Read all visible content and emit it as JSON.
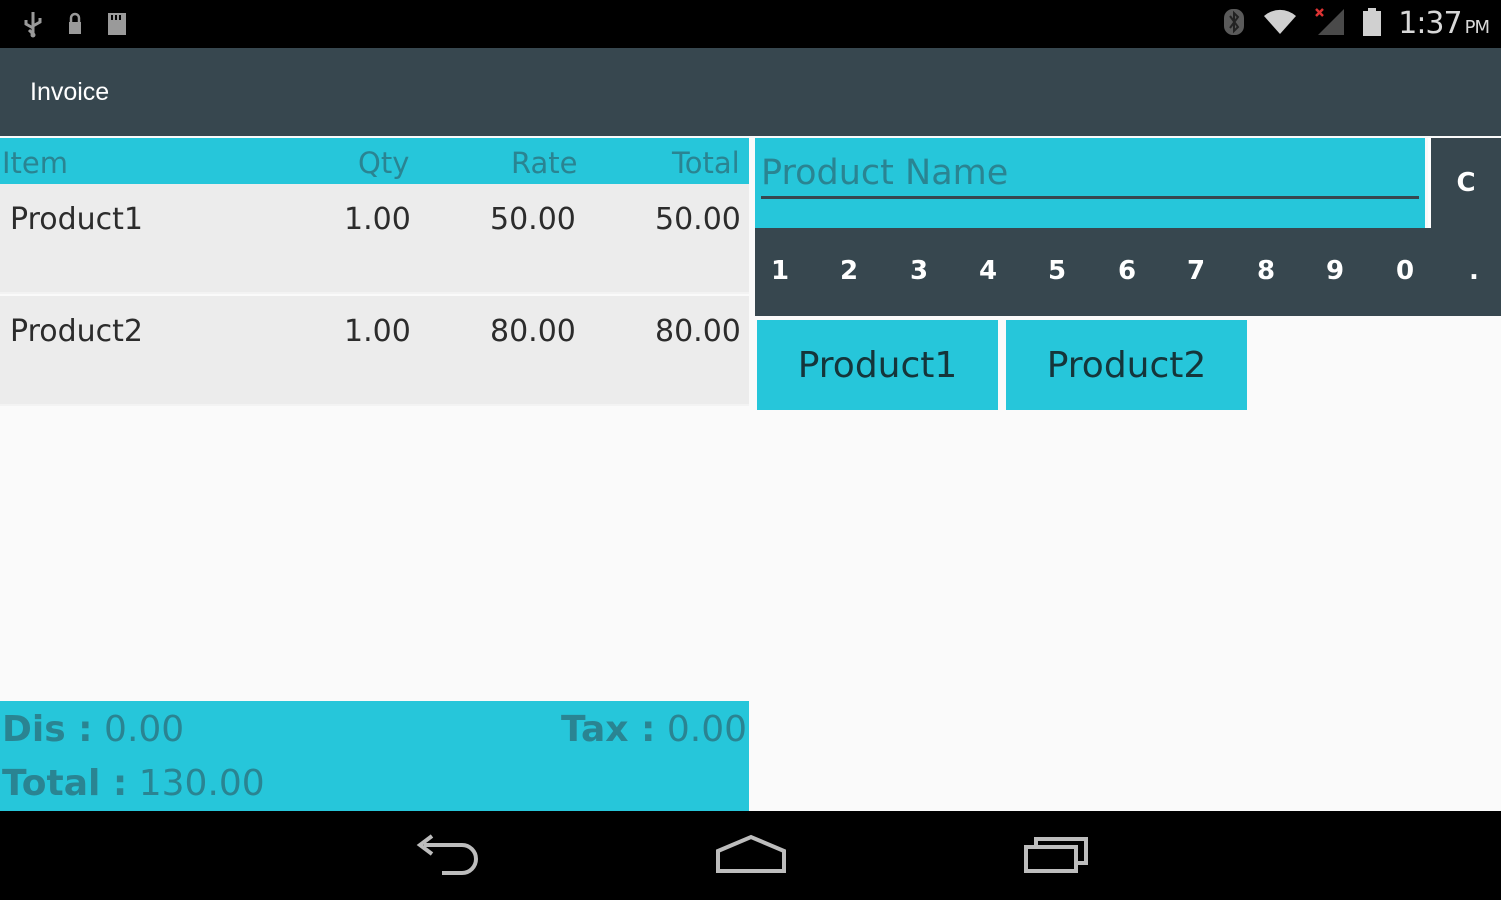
{
  "status_bar": {
    "time": "1:37",
    "ampm": "PM",
    "left_icons": [
      "usb-icon",
      "lock-icon",
      "sd-card-icon"
    ],
    "right_icons": [
      "bluetooth-icon",
      "wifi-icon",
      "signal-icon",
      "battery-icon"
    ]
  },
  "action_bar": {
    "title": "Invoice"
  },
  "table": {
    "headers": {
      "item": "Item",
      "qty": "Qty",
      "rate": "Rate",
      "total": "Total"
    },
    "rows": [
      {
        "item": "Product1",
        "qty": "1.00",
        "rate": "50.00",
        "total": "50.00"
      },
      {
        "item": "Product2",
        "qty": "1.00",
        "rate": "80.00",
        "total": "80.00"
      }
    ]
  },
  "search": {
    "placeholder": "Product Name",
    "value": ""
  },
  "clear_label": "C",
  "keypad": [
    "1",
    "2",
    "3",
    "4",
    "5",
    "6",
    "7",
    "8",
    "9",
    "0",
    "."
  ],
  "products": [
    "Product1",
    "Product2"
  ],
  "summary": {
    "dis_label": "Dis :",
    "dis_value": "0.00",
    "tax_label": "Tax :",
    "tax_value": "0.00",
    "total_label": "Total :",
    "total_value": "130.00"
  },
  "nav": [
    "back-icon",
    "home-icon",
    "recent-apps-icon"
  ],
  "colors": {
    "accent": "#26c6da",
    "dark": "#37474f",
    "text_accent": "#2a8492"
  }
}
